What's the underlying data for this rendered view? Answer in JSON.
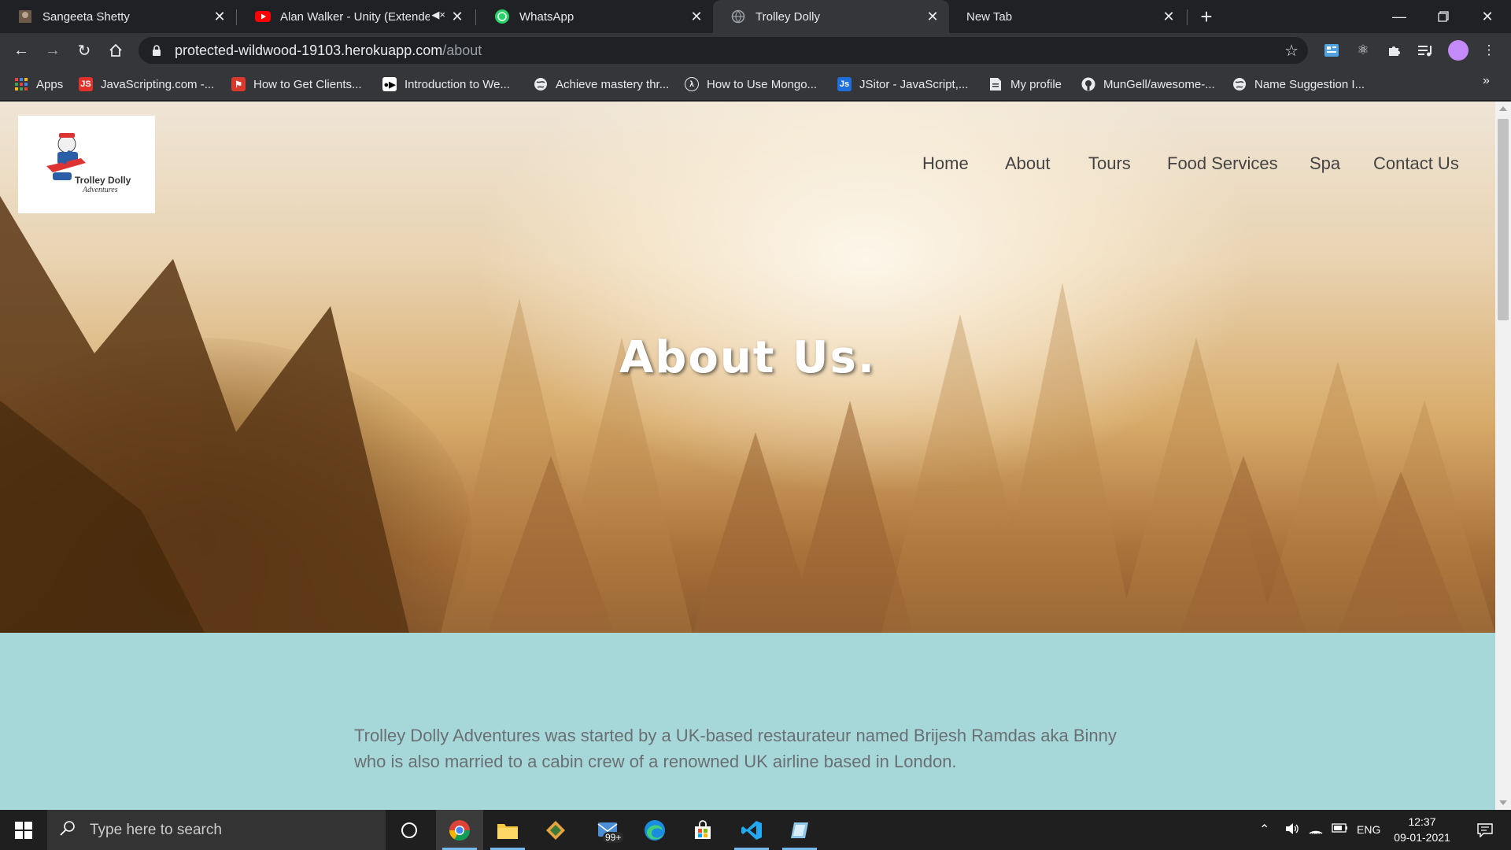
{
  "browser": {
    "tabs": [
      {
        "title": "Sangeeta Shetty",
        "active": false
      },
      {
        "title": "Alan Walker - Unity (Extended",
        "active": false,
        "muted": true
      },
      {
        "title": "WhatsApp",
        "active": false
      },
      {
        "title": "Trolley Dolly",
        "active": true
      },
      {
        "title": "New Tab",
        "active": false
      }
    ],
    "url_host": "protected-wildwood-19103.herokuapp.com",
    "url_path": "/about",
    "bookmarks": [
      {
        "label": "Apps",
        "icon": "apps-grid-icon"
      },
      {
        "label": "JavaScripting.com -...",
        "icon": "javascripting-icon"
      },
      {
        "label": "How to Get Clients...",
        "icon": "flag-icon"
      },
      {
        "label": "Introduction to We...",
        "icon": "video-camera-icon"
      },
      {
        "label": "Achieve mastery thr...",
        "icon": "globe-icon"
      },
      {
        "label": "How to Use Mongo...",
        "icon": "lambda-icon"
      },
      {
        "label": "JSitor - JavaScript,...",
        "icon": "jsitor-icon"
      },
      {
        "label": "My profile",
        "icon": "document-icon"
      },
      {
        "label": "MunGell/awesome-...",
        "icon": "github-icon"
      },
      {
        "label": "Name Suggestion I...",
        "icon": "globe-icon"
      }
    ]
  },
  "site": {
    "logo": {
      "line1": "Trolley Dolly",
      "line2": "Adventures"
    },
    "nav": [
      "Home",
      "About",
      "Tours",
      "Food Services",
      "Spa",
      "Contact Us"
    ],
    "hero_title": "About Us.",
    "about_paragraph": "Trolley Dolly Adventures was started by a UK-based restaurateur named Brijesh Ramdas aka Binny who is also married to a cabin crew of a renowned UK airline based in London."
  },
  "taskbar": {
    "search_placeholder": "Type here to search",
    "mail_badge": "99+",
    "language": "ENG",
    "time": "12:37",
    "date": "09-01-2021"
  },
  "colors": {
    "about_bg": "#a7d8d9",
    "nav_text": "#444444",
    "about_text": "#6a6f73",
    "chrome_dark": "#202124",
    "chrome_toolbar": "#35363a"
  }
}
